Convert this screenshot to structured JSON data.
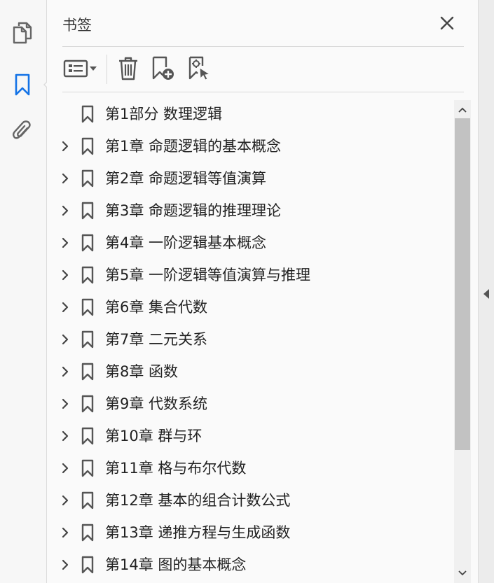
{
  "panel": {
    "title": "书签"
  },
  "rail": {
    "items": [
      {
        "icon": "pages-icon"
      },
      {
        "icon": "bookmark-icon",
        "active": true,
        "color": "#1473e6"
      },
      {
        "icon": "attachment-icon"
      }
    ]
  },
  "toolbar": {
    "options": {
      "icon": "options-menu-icon"
    },
    "delete": {
      "icon": "trash-icon"
    },
    "new_bookmark": {
      "icon": "add-bookmark-icon"
    },
    "bookmark_from_selection": {
      "icon": "bookmark-selection-icon"
    }
  },
  "bookmarks": [
    {
      "label": "第1部分  数理逻辑",
      "expandable": false
    },
    {
      "label": "第1章  命题逻辑的基本概念",
      "expandable": true
    },
    {
      "label": "第2章  命题逻辑等值演算",
      "expandable": true
    },
    {
      "label": "第3章  命题逻辑的推理理论",
      "expandable": true
    },
    {
      "label": "第4章  一阶逻辑基本概念",
      "expandable": true
    },
    {
      "label": "第5章  一阶逻辑等值演算与推理",
      "expandable": true
    },
    {
      "label": "第6章  集合代数",
      "expandable": true
    },
    {
      "label": "第7章  二元关系",
      "expandable": true
    },
    {
      "label": "第8章  函数",
      "expandable": true
    },
    {
      "label": "第9章  代数系统",
      "expandable": true
    },
    {
      "label": "第10章  群与环",
      "expandable": true
    },
    {
      "label": "第11章  格与布尔代数",
      "expandable": true
    },
    {
      "label": "第12章  基本的组合计数公式",
      "expandable": true
    },
    {
      "label": "第13章  递推方程与生成函数",
      "expandable": true
    },
    {
      "label": "第14章  图的基本概念",
      "expandable": true
    }
  ]
}
